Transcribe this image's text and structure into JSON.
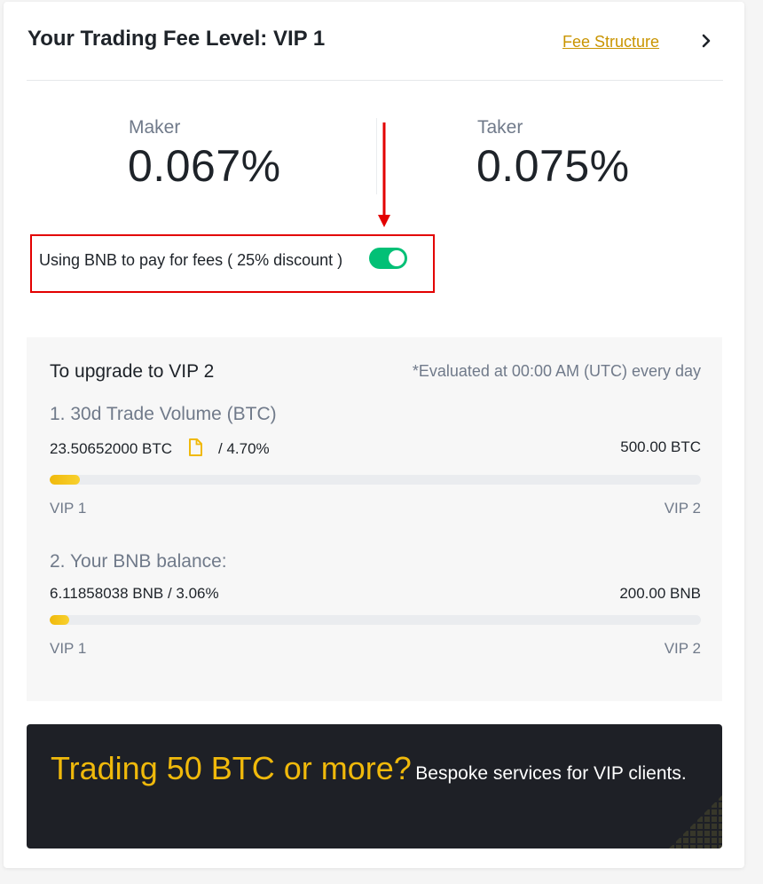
{
  "header": {
    "title": "Your Trading Fee Level: VIP 1",
    "fee_structure_link": "Fee Structure",
    "chevron_icon": "chevron-right-icon"
  },
  "rates": {
    "maker_label": "Maker",
    "maker_value": "0.067%",
    "taker_label": "Taker",
    "taker_value": "0.075%"
  },
  "bnb_fees": {
    "label": "Using BNB to pay for fees ( 25% discount )",
    "toggle_on": true,
    "toggle_color": "#02c076"
  },
  "annotation": {
    "arrow_color": "#e30000",
    "box_color": "#e30000"
  },
  "upgrade": {
    "title": "To upgrade to VIP 2",
    "note": "*Evaluated at 00:00 AM (UTC) every day",
    "requirements": [
      {
        "title": "1. 30d Trade Volume (BTC)",
        "current": "23.50652000 BTC",
        "percent_text": "/ 4.70%",
        "progress_percent": 4.7,
        "target": "500.00 BTC",
        "from_level": "VIP 1",
        "to_level": "VIP 2",
        "icon": "file-icon"
      },
      {
        "title": "2. Your BNB balance:",
        "current_with_percent": "6.11858038 BNB / 3.06%",
        "progress_percent": 3.06,
        "target": "200.00 BNB",
        "from_level": "VIP 1",
        "to_level": "VIP 2"
      }
    ]
  },
  "banner": {
    "headline": "Trading 50 BTC or more?",
    "subtext": "Bespoke services for VIP clients."
  },
  "colors": {
    "accent_gold": "#f0b90b",
    "link_gold": "#c99400",
    "banner_bg": "#1e2026"
  }
}
